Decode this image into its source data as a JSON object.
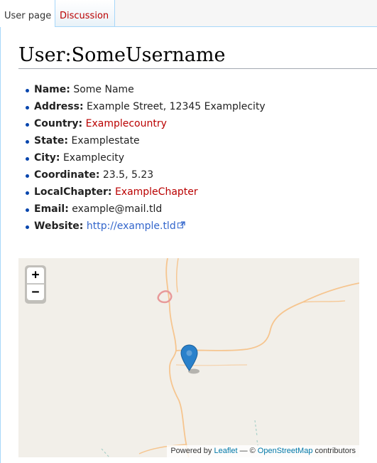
{
  "tabs": [
    {
      "label": "User page",
      "active": true
    },
    {
      "label": "Discussion",
      "active": false,
      "color": "#ba0000"
    }
  ],
  "page": {
    "title": "User:SomeUsername"
  },
  "properties": [
    {
      "label": "Name:",
      "value": "Some Name",
      "type": "text"
    },
    {
      "label": "Address:",
      "value": "Example Street, 12345 Examplecity",
      "type": "text"
    },
    {
      "label": "Country:",
      "value": "Examplecountry",
      "type": "redlink"
    },
    {
      "label": "State:",
      "value": "Examplestate",
      "type": "text"
    },
    {
      "label": "City:",
      "value": "Examplecity",
      "type": "text"
    },
    {
      "label": "Coordinate:",
      "value": "23.5, 5.23",
      "type": "text"
    },
    {
      "label": "LocalChapter:",
      "value": "ExampleChapter",
      "type": "redlink"
    },
    {
      "label": "Email:",
      "value": "example@mail.tld",
      "type": "text"
    },
    {
      "label": "Website:",
      "value": "http://example.tld",
      "type": "external-link"
    }
  ],
  "map": {
    "zoom_in": "+",
    "zoom_out": "−",
    "marker_icon": "map-pin-icon",
    "attribution": {
      "prefix": "Powered by",
      "leaflet": "Leaflet",
      "separator": "— ©",
      "osm": "OpenStreetMap",
      "suffix": "contributors"
    }
  },
  "colors": {
    "redlink": "#ba0000",
    "link": "#3366cc",
    "tab_border": "#a7d7f9",
    "map_background": "#f2efe9",
    "road": "#f9c78a",
    "marker": "#2a81cb"
  }
}
